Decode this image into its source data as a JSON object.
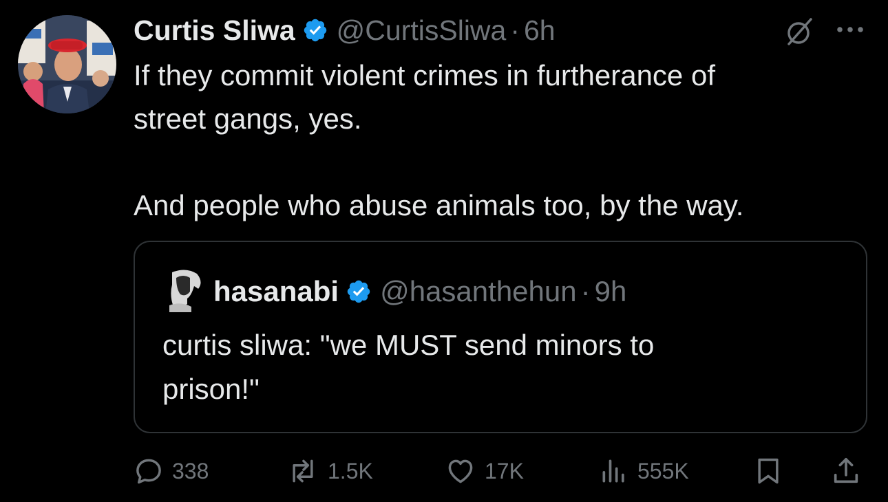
{
  "tweet": {
    "author": {
      "name": "Curtis Sliwa",
      "handle": "@CurtisSliwa",
      "verified": true
    },
    "separator": "·",
    "time": "6h",
    "text_lines": [
      "If they commit violent crimes in furtherance of",
      "street gangs, yes.",
      "And people who abuse animals too, by the way."
    ]
  },
  "quote": {
    "author": {
      "name": "hasanabi",
      "handle": "@hasanthehun",
      "verified": true
    },
    "separator": "·",
    "time": "9h",
    "text_lines": [
      "curtis sliwa: \"we MUST send minors to",
      "prison!\""
    ]
  },
  "actions": {
    "replies": "338",
    "reposts": "1.5K",
    "likes": "17K",
    "views": "555K"
  },
  "icons": {
    "verified": "verified-badge-icon",
    "grok": "grok-icon",
    "more": "more-icon",
    "reply": "reply-icon",
    "repost": "repost-icon",
    "like": "heart-icon",
    "views": "views-icon",
    "bookmark": "bookmark-icon",
    "share": "share-icon"
  },
  "colors": {
    "background": "#000000",
    "primary_text": "#e7e9ea",
    "secondary_text": "#71767b",
    "border": "#2f3336",
    "verified_blue": "#1d9bf0"
  }
}
